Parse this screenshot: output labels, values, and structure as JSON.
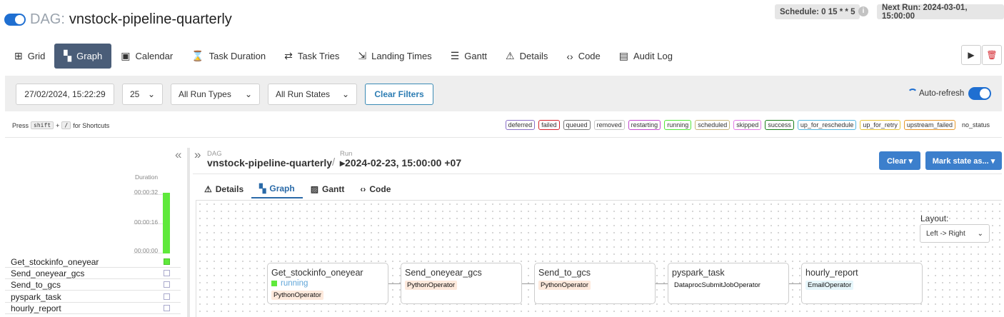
{
  "header": {
    "dag_label": "DAG:",
    "dag_id": "vnstock-pipeline-quarterly",
    "schedule": "Schedule: 0 15 * * 5",
    "info_glyph": "i",
    "next_run": "Next Run: 2024-03-01, 15:00:00"
  },
  "nav": [
    {
      "label": "Grid",
      "icon": "grid-icon",
      "glyph": "⊞"
    },
    {
      "label": "Graph",
      "icon": "graph-icon",
      "glyph": "▚"
    },
    {
      "label": "Calendar",
      "icon": "calendar-icon",
      "glyph": "▣"
    },
    {
      "label": "Task Duration",
      "icon": "hourglass-icon",
      "glyph": "⌛"
    },
    {
      "label": "Task Tries",
      "icon": "retry-icon",
      "glyph": "⇄"
    },
    {
      "label": "Landing Times",
      "icon": "landing-icon",
      "glyph": "⇲"
    },
    {
      "label": "Gantt",
      "icon": "gantt-icon",
      "glyph": "☰"
    },
    {
      "label": "Details",
      "icon": "warning-icon",
      "glyph": "⚠"
    },
    {
      "label": "Code",
      "icon": "code-icon",
      "glyph": "‹›"
    },
    {
      "label": "Audit Log",
      "icon": "audit-icon",
      "glyph": "▤"
    }
  ],
  "actions": {
    "play_glyph": "▶",
    "delete_glyph": "🗑"
  },
  "filters": {
    "date": "27/02/2024, 15:22:29",
    "num_runs": "25",
    "run_type": "All Run Types",
    "run_state": "All Run States",
    "clear_label": "Clear Filters",
    "auto_refresh": "Auto-refresh",
    "chevron": "⌄"
  },
  "shortcut": {
    "press": "Press",
    "key1": "shift",
    "plus": "+",
    "key2": "/",
    "suffix": "for Shortcuts"
  },
  "legend": [
    {
      "label": "deferred",
      "color": "#8a6fc7"
    },
    {
      "label": "failed",
      "color": "#d4242c"
    },
    {
      "label": "queued",
      "color": "#7a7a7a"
    },
    {
      "label": "removed",
      "color": "#c8c8c8"
    },
    {
      "label": "restarting",
      "color": "#c34ccf"
    },
    {
      "label": "running",
      "color": "#55e63a"
    },
    {
      "label": "scheduled",
      "color": "#c9b77a"
    },
    {
      "label": "skipped",
      "color": "#e37be6"
    },
    {
      "label": "success",
      "color": "#1a7e1a"
    },
    {
      "label": "up_for_reschedule",
      "color": "#54b7e0"
    },
    {
      "label": "up_for_retry",
      "color": "#e6c53a"
    },
    {
      "label": "upstream_failed",
      "color": "#e89a2c"
    },
    {
      "label": "no_status",
      "color": "none"
    }
  ],
  "grid": {
    "duration_label": "Duration",
    "ticks": [
      "00:00:32",
      "00:00:16",
      "00:00:00"
    ],
    "collapse_glyph": "«",
    "run_duration_fraction": 1.0,
    "tasks": [
      {
        "name": "Get_stockinfo_oneyear",
        "state": "running"
      },
      {
        "name": "Send_oneyear_gcs",
        "state": "none"
      },
      {
        "name": "Send_to_gcs",
        "state": "none"
      },
      {
        "name": "pyspark_task",
        "state": "none"
      },
      {
        "name": "hourly_report",
        "state": "none"
      }
    ]
  },
  "detail": {
    "expand_glyph": "»",
    "dag_small": "DAG",
    "dag_big": "vnstock-pipeline-quarterly",
    "slash": "/",
    "run_small": "Run",
    "run_big": "▸2024-02-23, 15:00:00 +07",
    "clear_btn": "Clear ▾",
    "mark_btn": "Mark state as... ▾",
    "tabs": [
      {
        "label": "Details",
        "icon": "warning-icon",
        "glyph": "⚠"
      },
      {
        "label": "Graph",
        "icon": "graph-icon",
        "glyph": "▚"
      },
      {
        "label": "Gantt",
        "icon": "gantt-icon",
        "glyph": "▨"
      },
      {
        "label": "Code",
        "icon": "code-icon",
        "glyph": "‹›"
      }
    ],
    "layout_label": "Layout:",
    "layout_value": "Left -> Right",
    "nodes": [
      {
        "name": "Get_stockinfo_oneyear",
        "status": "running",
        "operator": "PythonOperator",
        "op_color": "#fde9dc"
      },
      {
        "name": "Send_oneyear_gcs",
        "status": "",
        "operator": "PythonOperator",
        "op_color": "#fde9dc"
      },
      {
        "name": "Send_to_gcs",
        "status": "",
        "operator": "PythonOperator",
        "op_color": "#fde9dc"
      },
      {
        "name": "pyspark_task",
        "status": "",
        "operator": "DataprocSubmitJobOperator",
        "op_color": "#ffffff"
      },
      {
        "name": "hourly_report",
        "status": "",
        "operator": "EmailOperator",
        "op_color": "#e6f6fb"
      }
    ]
  }
}
